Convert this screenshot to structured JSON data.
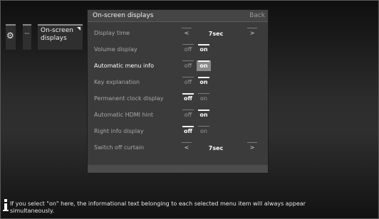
{
  "breadcrumb": {
    "gear_icon": "gear-icon",
    "ellipsis": "···",
    "current": "On-screen displays"
  },
  "panel": {
    "title": "On-screen displays",
    "back_label": "Back",
    "rows": [
      {
        "label": "Display time",
        "type": "stepper",
        "value": "7sec",
        "left": "<",
        "right": ">"
      },
      {
        "label": "Volume display",
        "type": "toggle",
        "off": "off",
        "on": "on",
        "selected": "on"
      },
      {
        "label": "Automatic menu info",
        "type": "toggle",
        "off": "off",
        "on": "on",
        "selected": "on",
        "focused": true
      },
      {
        "label": "Key explanation",
        "type": "toggle",
        "off": "off",
        "on": "on",
        "selected": "on"
      },
      {
        "label": "Permanent clock display",
        "type": "toggle",
        "off": "off",
        "on": "on",
        "selected": "off"
      },
      {
        "label": "Automatic HDMI hint",
        "type": "toggle",
        "off": "off",
        "on": "on",
        "selected": "on"
      },
      {
        "label": "Right info display",
        "type": "toggle",
        "off": "off",
        "on": "on",
        "selected": "off"
      },
      {
        "label": "Switch off curtain",
        "type": "stepper",
        "value": "7sec",
        "left": "<",
        "right": ">"
      }
    ]
  },
  "info": {
    "line1": "If you select \"on\" here, the informational text belonging to each selected menu item will always appear",
    "line2": "simultaneously."
  },
  "colors": {
    "panel_bg": "#3b3b3b",
    "highlight": "#8a8a8a",
    "text_active": "#ffffff",
    "text_inactive": "#a8a8a8"
  }
}
